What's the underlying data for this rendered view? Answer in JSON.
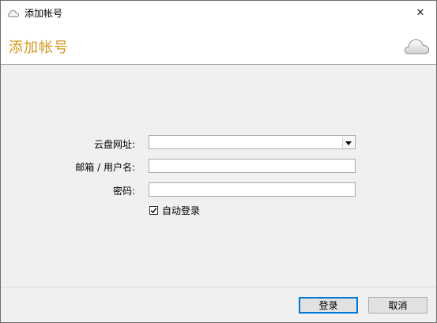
{
  "window": {
    "title": "添加帐号",
    "close_glyph": "✕"
  },
  "banner": {
    "heading": "添加帐号",
    "logo_icon": "cloud-icon",
    "accent_color": "#d39a1e"
  },
  "form": {
    "cloud_url_label": "云盘网址:",
    "cloud_url_value": "",
    "email_label": "邮箱 / 用户名:",
    "email_value": "",
    "password_label": "密码:",
    "password_value": "",
    "auto_login_label": "自动登录",
    "auto_login_checked": true
  },
  "footer": {
    "login_label": "登录",
    "cancel_label": "取消"
  }
}
